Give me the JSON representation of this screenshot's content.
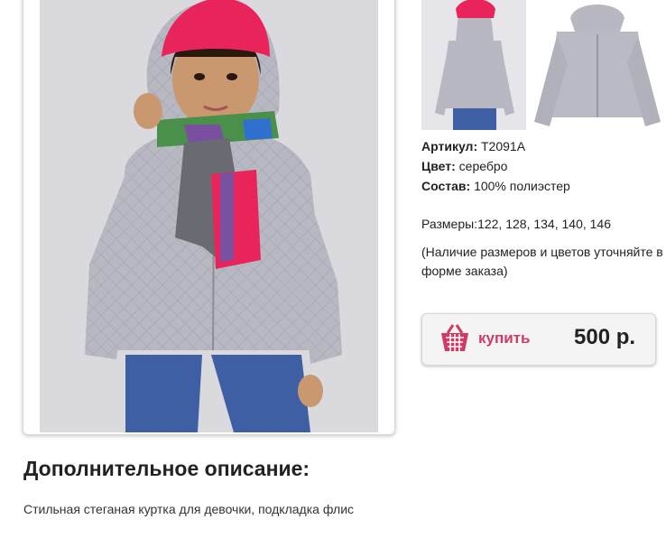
{
  "product": {
    "article_label": "Артикул:",
    "article_value": "T2091A",
    "color_label": "Цвет:",
    "color_value": "серебро",
    "composition_label": "Состав:",
    "composition_value": "100% полиэстер",
    "sizes_label": "Размеры:",
    "sizes_value": "122, 128, 134, 140, 146",
    "availability_note": "(Наличие размеров и цветов уточняйте в форме заказа)"
  },
  "buy": {
    "label": "купить",
    "price": "500 р.",
    "icon": "basket-icon"
  },
  "description": {
    "title": "Дополнительное описание:",
    "text": "Стильная стеганая куртка для девочки, подкладка флис"
  },
  "colors": {
    "accent": "#d23a63",
    "jacket": "#b9bac3",
    "hat": "#e8245a"
  }
}
